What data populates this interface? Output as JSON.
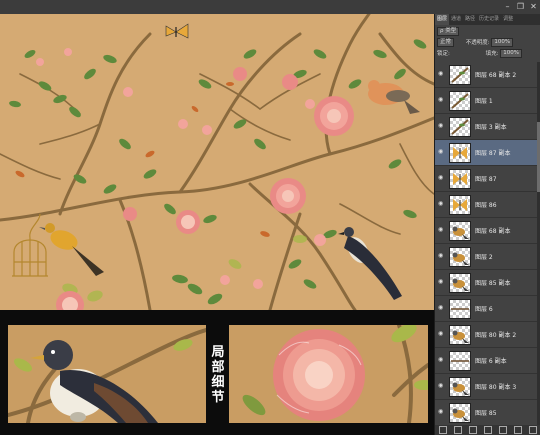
{
  "panel": {
    "tabs": [
      "图层",
      "通道",
      "路径",
      "历史记录",
      "调整"
    ],
    "kind_filter": "ρ 类型",
    "blend_mode": "正常",
    "opacity_label": "不透明度:",
    "opacity_value": "100%",
    "lock_label": "锁定:",
    "fill_label": "填充:",
    "fill_value": "100%"
  },
  "layers": [
    {
      "name": "图层 68 副本 2",
      "thumb": "twig"
    },
    {
      "name": "图层 1",
      "thumb": "twig"
    },
    {
      "name": "图层 3 副本",
      "thumb": "twig"
    },
    {
      "name": "图层 87 副本",
      "thumb": "butterfly",
      "selected": true
    },
    {
      "name": "图层 87",
      "thumb": "butterfly"
    },
    {
      "name": "图层 86",
      "thumb": "butterfly"
    },
    {
      "name": "图层 68 副本",
      "thumb": "bird"
    },
    {
      "name": "图层 2",
      "thumb": "bird"
    },
    {
      "name": "图层 85 副本",
      "thumb": "bird"
    },
    {
      "name": "图层 6",
      "thumb": "line"
    },
    {
      "name": "图层 80 副本 2",
      "thumb": "bird"
    },
    {
      "name": "图层 6 副本",
      "thumb": "line"
    },
    {
      "name": "图层 80 副本 3",
      "thumb": "bird"
    },
    {
      "name": "图层 85",
      "thumb": "bird"
    }
  ],
  "detail_caption": "局部细节"
}
